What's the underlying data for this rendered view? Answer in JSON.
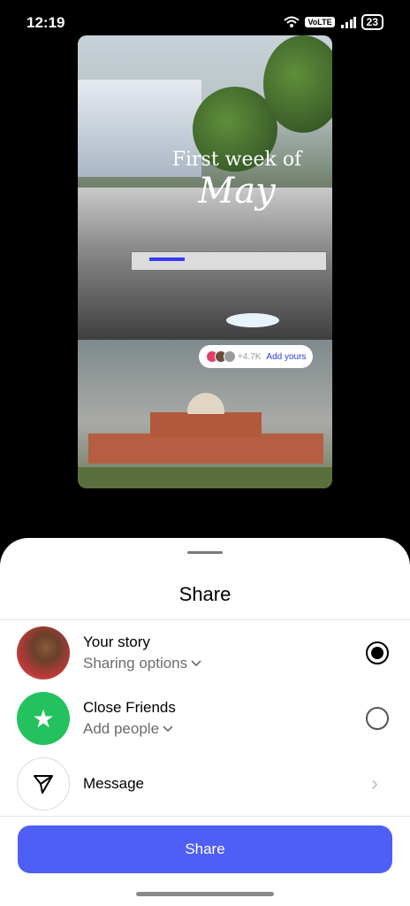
{
  "status_bar": {
    "time": "12:19",
    "volte": "VoLTE",
    "battery": "23"
  },
  "preview": {
    "title_line1": "First week of",
    "title_line2": "May",
    "add_yours": {
      "count": "+4.7K",
      "label": "Add yours"
    }
  },
  "sheet": {
    "title": "Share",
    "rows": [
      {
        "title": "Your story",
        "subtitle": "Sharing options",
        "selected": true
      },
      {
        "title": "Close Friends",
        "subtitle": "Add people",
        "selected": false
      },
      {
        "title": "Message"
      }
    ],
    "share_button": "Share"
  },
  "colors": {
    "accent": "#4f5ef5",
    "close_friends": "#23c25f"
  }
}
